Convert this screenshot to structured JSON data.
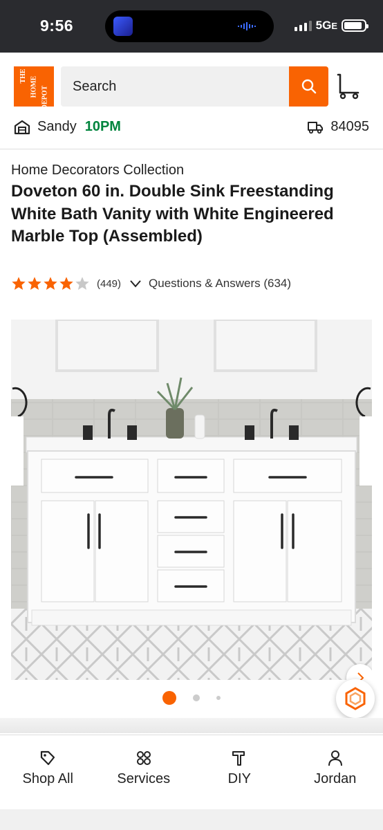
{
  "status_bar": {
    "time": "9:56",
    "network": "5G",
    "network_suffix": "E",
    "battery_level": 0.9
  },
  "header": {
    "logo_text": [
      "THE",
      "HOME",
      "DEPOT"
    ],
    "search": {
      "placeholder": "Search"
    },
    "store": {
      "name": "Sandy",
      "hours": "10PM"
    },
    "zip": "84095"
  },
  "product": {
    "brand": "Home Decorators Collection",
    "title": "Doveton 60 in. Double Sink Freestanding White Bath Vanity with White Engineered Marble Top (Assembled)",
    "rating": 4,
    "rating_max": 5,
    "review_count": "(449)",
    "qa_label": "Questions & Answers (634)"
  },
  "gallery": {
    "image_count": 3,
    "active_index": 0
  },
  "bottom_nav": {
    "items": [
      {
        "label": "Shop All",
        "icon": "tag-icon"
      },
      {
        "label": "Services",
        "icon": "services-icon"
      },
      {
        "label": "DIY",
        "icon": "hammer-icon"
      },
      {
        "label": "Jordan",
        "icon": "person-icon"
      }
    ]
  },
  "colors": {
    "brand_orange": "#f96302",
    "hours_green": "#00843d",
    "status_bar": "#2a2b2f"
  }
}
